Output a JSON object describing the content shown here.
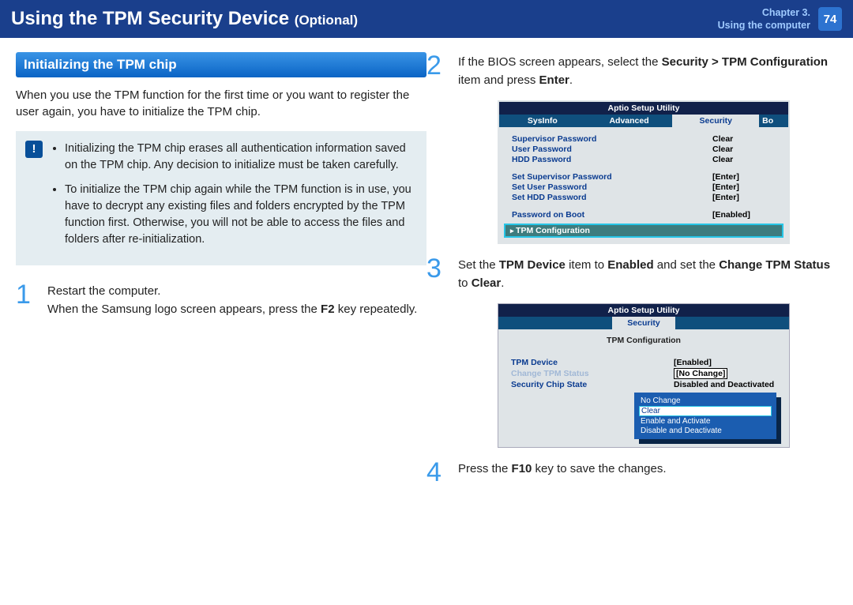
{
  "header": {
    "title_main": "Using the TPM Security Device",
    "title_sub": "(Optional)",
    "chapter_line1": "Chapter 3.",
    "chapter_line2": "Using the computer",
    "page_number": "74"
  },
  "left": {
    "section_title": "Initializing the TPM chip",
    "intro": "When you use the TPM function for the first time or you want to register the user again, you have to initialize the TPM chip.",
    "note1": "Initializing the TPM chip erases all authentication information saved on the TPM chip. Any decision to initialize must be taken carefully.",
    "note2": "To initialize the TPM chip again while the TPM function is in use, you have to decrypt any existing files and folders encrypted by the TPM function first. Otherwise, you will not be able to access the files and folders after re-initialization."
  },
  "steps": {
    "s1_num": "1",
    "s1a": "Restart the computer.",
    "s1b_pre": "When the Samsung logo screen appears, press the ",
    "s1b_key": "F2",
    "s1b_post": " key repeatedly.",
    "s2_num": "2",
    "s2_pre": "If the BIOS screen appears, select the ",
    "s2_b1": "Security > TPM Configuration",
    "s2_mid": " item and press ",
    "s2_b2": "Enter",
    "s2_end": ".",
    "s3_num": "3",
    "s3_pre": "Set the ",
    "s3_b1": "TPM Device",
    "s3_mid1": " item to ",
    "s3_b2": "Enabled",
    "s3_mid2": " and set the ",
    "s3_b3": "Change TPM Status",
    "s3_mid3": " to ",
    "s3_b4": "Clear",
    "s3_end": ".",
    "s4_num": "4",
    "s4_pre": "Press the ",
    "s4_key": "F10",
    "s4_post": " key to save the changes."
  },
  "bios1": {
    "util": "Aptio Setup Utility",
    "tabs": {
      "t1": "SysInfo",
      "t2": "Advanced",
      "t3": "Security",
      "t4": "Bo"
    },
    "rows": [
      {
        "l": "Supervisor Password",
        "r": "Clear"
      },
      {
        "l": "User Password",
        "r": "Clear"
      },
      {
        "l": "HDD Password",
        "r": "Clear"
      }
    ],
    "rows2": [
      {
        "l": "Set Supervisor Password",
        "r": "[Enter]"
      },
      {
        "l": "Set User Password",
        "r": "[Enter]"
      },
      {
        "l": "Set HDD Password",
        "r": "[Enter]"
      }
    ],
    "rows3": [
      {
        "l": "Password on Boot",
        "r": "[Enabled]"
      }
    ],
    "highlight": "TPM Configuration"
  },
  "bios2": {
    "util": "Aptio Setup Utility",
    "tab": "Security",
    "cfg_title": "TPM Configuration",
    "rows": [
      {
        "l": "TPM Device",
        "r": "[Enabled]",
        "grey": false,
        "boxed": false
      },
      {
        "l": "Change TPM Status",
        "r": "[No Change]",
        "grey": true,
        "boxed": true
      },
      {
        "l": "Security Chip State",
        "r": "Disabled and Deactivated",
        "grey": false,
        "boxed": false
      }
    ],
    "popup": {
      "opts": [
        "No Change",
        "Clear",
        "Enable and Activate",
        "Disable and Deactivate"
      ],
      "selected": 1
    }
  }
}
